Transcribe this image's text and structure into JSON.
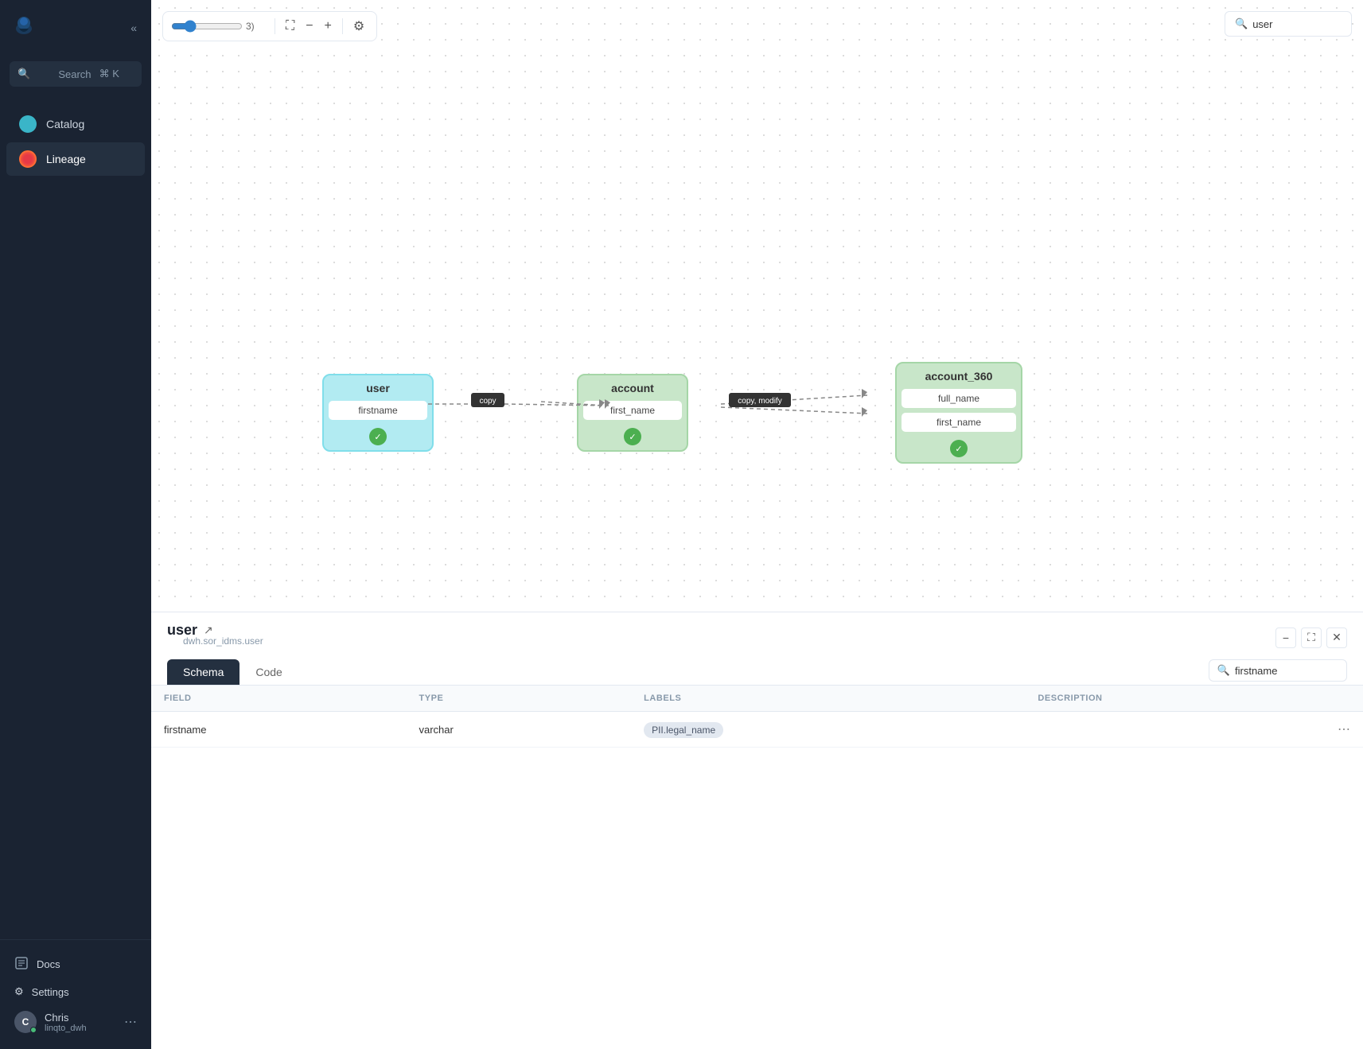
{
  "sidebar": {
    "collapse_label": "«",
    "search": {
      "placeholder": "Search",
      "shortcut": "⌘ K"
    },
    "nav_items": [
      {
        "id": "catalog",
        "label": "Catalog",
        "icon_type": "circle-teal",
        "active": false
      },
      {
        "id": "lineage",
        "label": "Lineage",
        "icon_type": "circle-red",
        "active": true
      }
    ],
    "footer_items": [
      {
        "id": "docs",
        "label": "Docs",
        "icon": "□"
      },
      {
        "id": "settings",
        "label": "Settings",
        "icon": "⚙"
      }
    ],
    "user": {
      "name": "Chris",
      "initials": "C",
      "org": "linqto_dwh",
      "status": "online"
    }
  },
  "canvas": {
    "toolbar": {
      "zoom_value": "3)",
      "fit_icon": "⛶",
      "zoom_out_icon": "−",
      "zoom_in_icon": "+",
      "settings_icon": "⚙"
    },
    "search": {
      "placeholder": "user",
      "value": "user"
    }
  },
  "lineage": {
    "nodes": [
      {
        "id": "user",
        "label": "user",
        "type": "source",
        "fields": [
          "firstname"
        ],
        "color": "cyan"
      },
      {
        "id": "account",
        "label": "account",
        "type": "middle",
        "fields": [
          "first_name"
        ],
        "color": "green"
      },
      {
        "id": "account_360",
        "label": "account_360",
        "type": "target",
        "fields": [
          "full_name",
          "first_name"
        ],
        "color": "green"
      }
    ],
    "edges": [
      {
        "from": "user.firstname",
        "to": "account.first_name",
        "label": "copy"
      },
      {
        "from": "account.first_name",
        "to": "account_360",
        "label": "copy, modify"
      }
    ]
  },
  "bottom_panel": {
    "title": "user",
    "subtitle": "dwh.sor_idms.user",
    "tabs": [
      "Schema",
      "Code"
    ],
    "active_tab": "Schema",
    "search_placeholder": "firstname",
    "search_value": "firstname",
    "table": {
      "headers": [
        "FIELD",
        "TYPE",
        "LABELS",
        "DESCRIPTION"
      ],
      "rows": [
        {
          "field": "firstname",
          "type": "varchar",
          "labels": [
            "PII.legal_name"
          ],
          "description": ""
        }
      ]
    }
  },
  "icons": {
    "search": "🔍",
    "external_link": "↗",
    "collapse": "≪",
    "docs": "□",
    "settings": "⚙",
    "three_dots": "⋯",
    "minus": "−",
    "plus": "+",
    "expand": "⛶",
    "chevron_down": "✓",
    "gear": "⚙"
  }
}
